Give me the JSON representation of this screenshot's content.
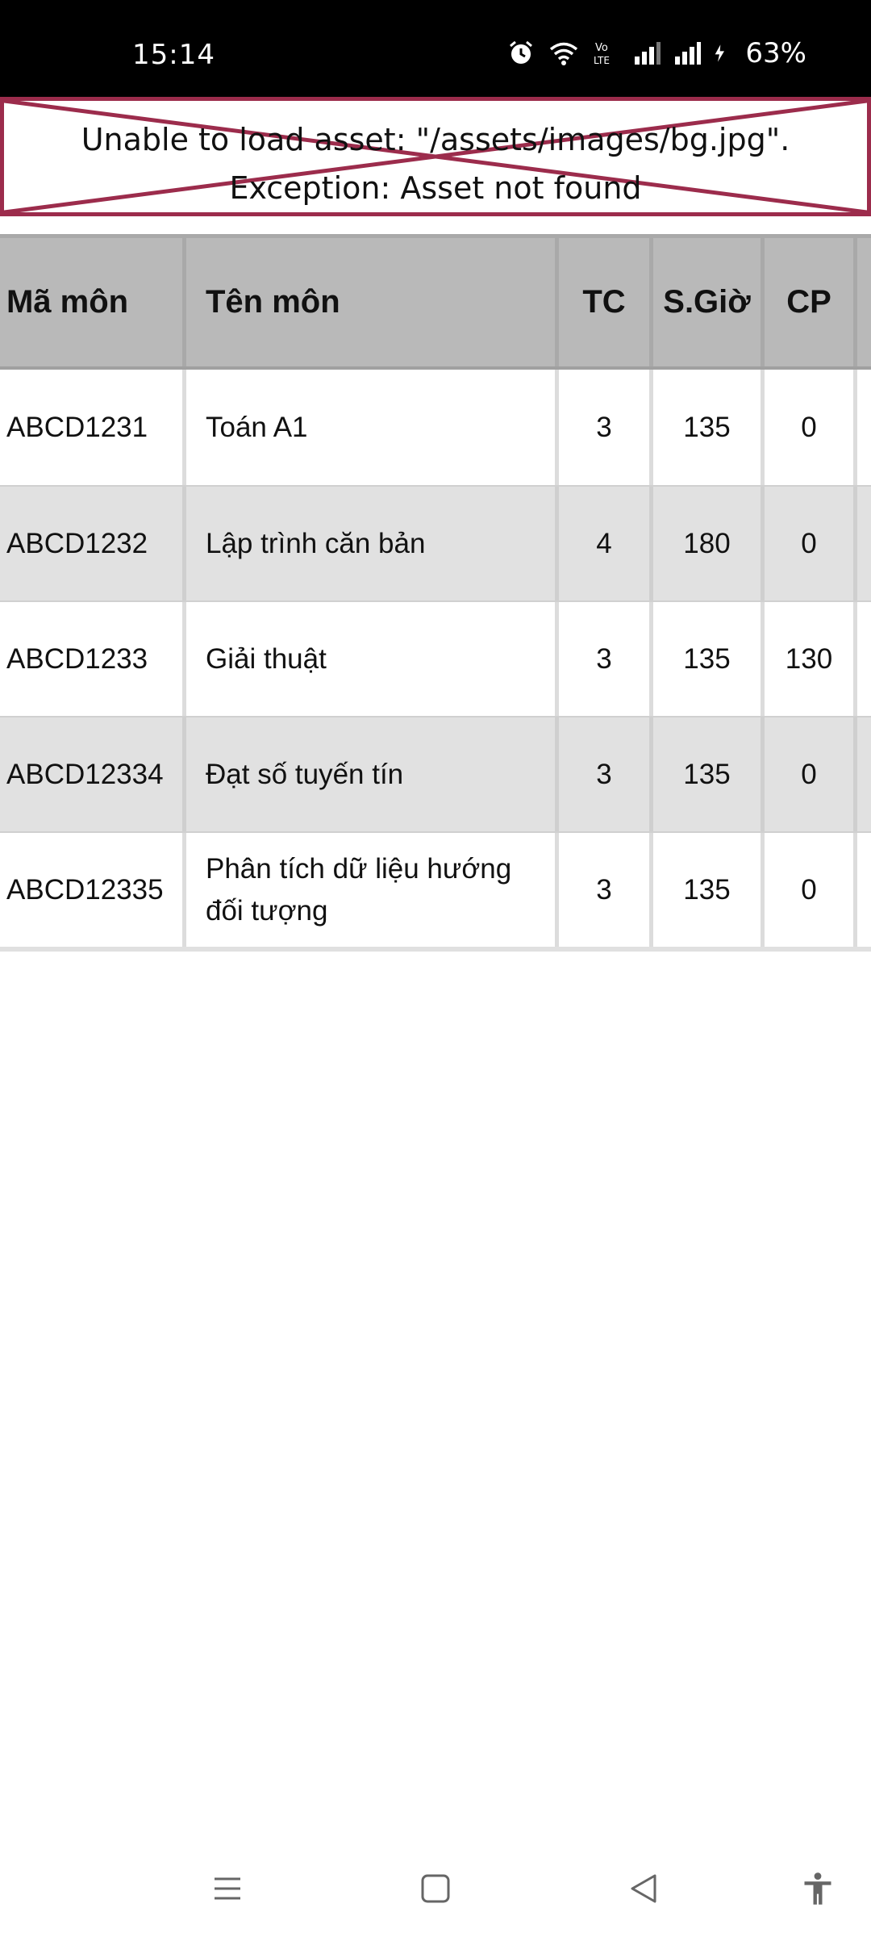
{
  "status_bar": {
    "time": "15:14",
    "battery": "63%"
  },
  "error_banner": {
    "line1": "Unable to load asset: \"/assets/images/bg.jpg\".",
    "line2": "Exception: Asset not found"
  },
  "table": {
    "headers": [
      "Mã môn",
      "Tên môn",
      "TC",
      "S.Giờ",
      "CP"
    ],
    "rows": [
      {
        "code": "ABCD1231",
        "name": "Toán A1",
        "tc": "3",
        "hours": "135",
        "cp": "0"
      },
      {
        "code": "ABCD1232",
        "name": "Lập trình căn bản",
        "tc": "4",
        "hours": "180",
        "cp": "0"
      },
      {
        "code": "ABCD1233",
        "name": "Giải thuật",
        "tc": "3",
        "hours": "135",
        "cp": "130"
      },
      {
        "code": "ABCD12334",
        "name": "Đạt số tuyến tín",
        "tc": "3",
        "hours": "135",
        "cp": "0"
      },
      {
        "code": "ABCD12335",
        "name": "Phân tích dữ liệu hướng đối tượng",
        "tc": "3",
        "hours": "135",
        "cp": "0"
      }
    ]
  },
  "nav_bar": {
    "icons": [
      "menu-icon",
      "home-icon",
      "back-icon",
      "accessibility-icon"
    ]
  },
  "colors": {
    "error_border": "#9c2c4c",
    "header_bg": "#b9b9b9",
    "row_alt_bg": "#e1e1e1"
  }
}
